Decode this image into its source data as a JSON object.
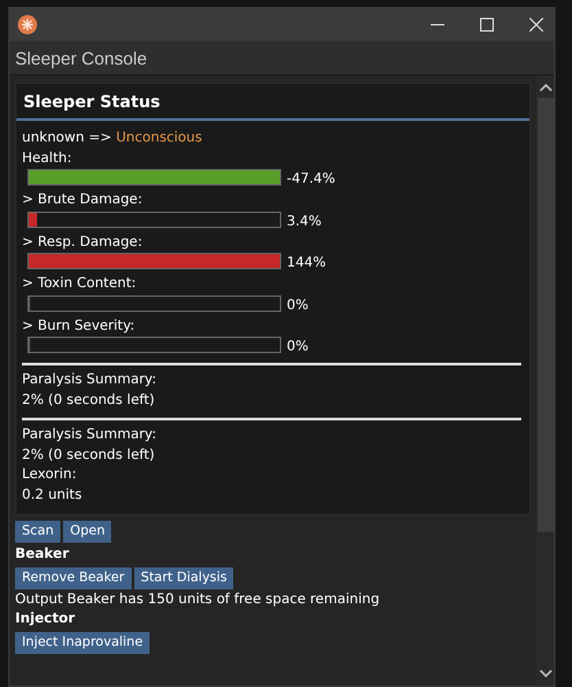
{
  "window": {
    "title": "Sleeper Console"
  },
  "status": {
    "title": "Sleeper Status",
    "subject": "unknown =>",
    "state": "Unconscious",
    "bars": [
      {
        "label": "Health:",
        "level": 1,
        "reading": "-47.4%",
        "color": "#5a9e2a"
      },
      {
        "label": "> Brute Damage:",
        "level": 0.034,
        "reading": "3.4%",
        "color": "#c62828"
      },
      {
        "label": "> Resp. Damage:",
        "level": 1,
        "reading": "144%",
        "color": "#c62828"
      },
      {
        "label": "> Toxin Content:",
        "level": 0,
        "reading": "0%"
      },
      {
        "label": "> Burn Severity:",
        "level": 0,
        "reading": "0%"
      }
    ],
    "groups": [
      [
        "Paralysis Summary:",
        "2% (0 seconds left)"
      ],
      [
        "Paralysis Summary:",
        "2% (0 seconds left)",
        "Lexorin:",
        "0.2 units"
      ]
    ]
  },
  "actions": [
    "Scan",
    "Open"
  ],
  "beaker": {
    "heading": "Beaker",
    "buttons": [
      "Remove Beaker",
      "Start Dialysis"
    ],
    "note": "Output Beaker has 150 units of free space remaining"
  },
  "injector": {
    "heading": "Injector",
    "buttons": [
      "Inject Inaprovaline"
    ]
  }
}
